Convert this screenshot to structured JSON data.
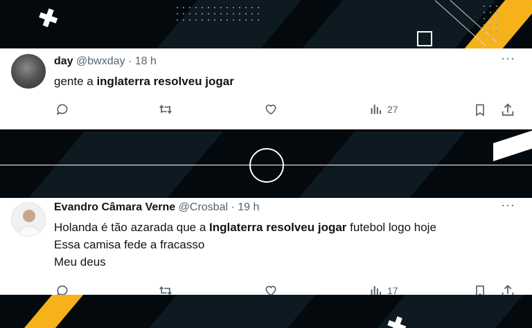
{
  "tweets": [
    {
      "name": "day",
      "handle": "@bwxday",
      "sep": "·",
      "time": "18 h",
      "lines": [
        {
          "pre": "gente a ",
          "bold": "inglaterra resolveu jogar",
          "post": ""
        }
      ],
      "views": "27",
      "more": "···"
    },
    {
      "name": "Evandro Câmara Verne",
      "handle": "@Crosbal",
      "sep": "·",
      "time": "19 h",
      "lines": [
        {
          "pre": "Holanda é tão azarada que a ",
          "bold": "Inglaterra resolveu jogar",
          "post": " futebol logo hoje"
        },
        {
          "pre": "Essa camisa fede a fracasso",
          "bold": "",
          "post": ""
        },
        {
          "pre": "Meu deus",
          "bold": "",
          "post": ""
        }
      ],
      "views": "17",
      "more": "···"
    }
  ],
  "colors": {
    "accent": "#f5b21a",
    "background": "#04090d",
    "text_muted": "#536471"
  },
  "icons": [
    "reply-icon",
    "retweet-icon",
    "like-icon",
    "views-icon",
    "bookmark-icon",
    "share-icon",
    "more-icon"
  ]
}
